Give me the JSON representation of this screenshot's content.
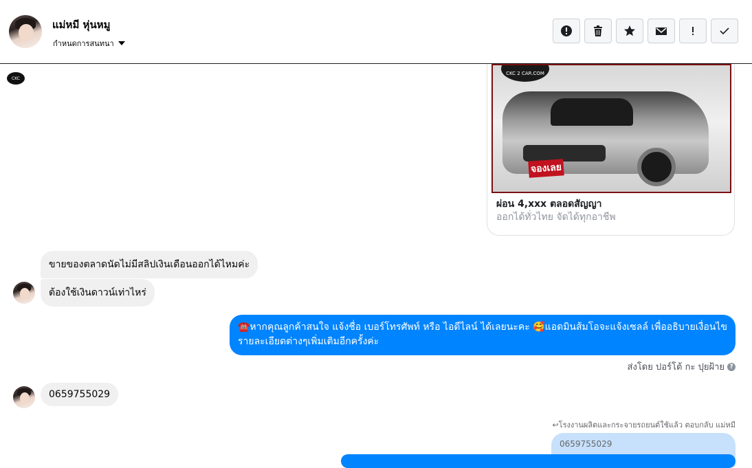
{
  "header": {
    "contact_name": "แม่หมี หุ่นหมู",
    "subtitle": "กำหนดการสนทนา",
    "actions": [
      {
        "name": "report-button",
        "icon": "alert-circle-icon"
      },
      {
        "name": "delete-button",
        "icon": "trash-icon"
      },
      {
        "name": "star-button",
        "icon": "star-icon"
      },
      {
        "name": "mark-unread-button",
        "icon": "envelope-icon"
      },
      {
        "name": "spam-button",
        "icon": "exclamation-icon"
      },
      {
        "name": "mark-done-button",
        "icon": "check-icon"
      }
    ]
  },
  "card": {
    "photo_logo": "CKC 2 CAR.COM",
    "photo_badge": "จองเลย",
    "title": "ผ่อน 4,xxx ตลอดสัญญา",
    "subtitle": "ออกได้ทั่วไทย จัดได้ทุกอาชีพ"
  },
  "messages": {
    "in_1": "ขายของตลาดนัดไม่มีสลิปเงินเดือนออกได้ไหมค่ะ",
    "in_2": "ต้องใช้เงินดาวน์เท่าไหร่",
    "out_1": "☎️หากคุณลูกค้าสนใจ แจ้งชื่อ เบอร์โทรศัพท์ หรือ ไอดีไลน์  ได้เลยนะคะ 🥰แอดมินส้มโอจะแจ้งเซลล์   เพื่ออธิบายเงื่อนไขรายละเอียดต่างๆเพิ่มเติมอีกครั้งค่ะ",
    "sent_by": "ส่งโดย ปอร์โต้ กะ ปุยฝ้าย",
    "in_3": "0659755029",
    "reply_note": "↩โรงงานผลิตและกระจายรถยนต์ใช้แล้ว ตอบกลับ แม่หมี",
    "reply_quote": "0659755029"
  },
  "colors": {
    "outgoing_bubble": "#0084ff",
    "incoming_bubble": "#f0f0f0",
    "reply_quote": "#c7e0fb"
  }
}
